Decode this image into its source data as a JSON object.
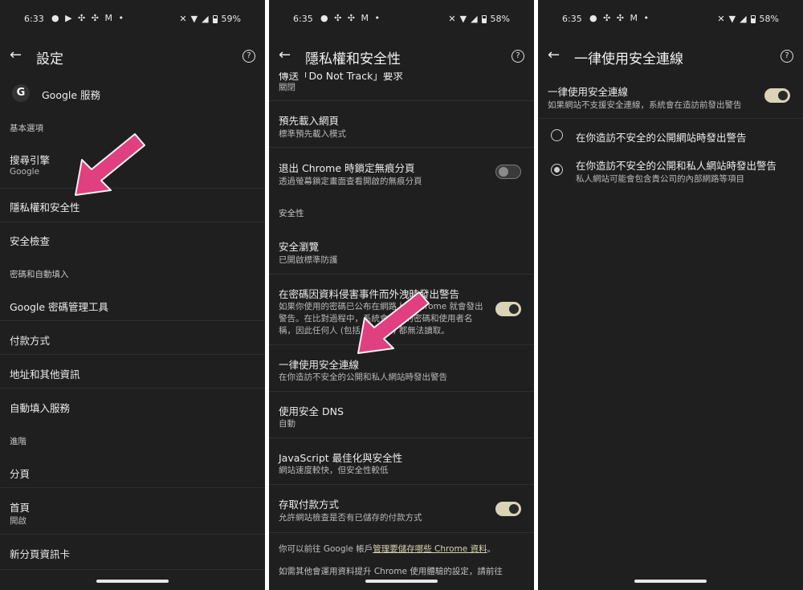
{
  "status_bars": {
    "p1": {
      "time": "6:33",
      "notif": "● ▶ ✣ ✣ M •",
      "battery": "59%"
    },
    "p2": {
      "time": "6:35",
      "notif": "● ✣ ✣ M •",
      "battery": "58%"
    },
    "p3": {
      "time": "6:35",
      "notif": "● ✣ ✣ M •",
      "battery": "58%"
    }
  },
  "panel1": {
    "title": "設定",
    "google_label": "Google 服務",
    "sections": {
      "basic": "基本選項",
      "passwords": "密碼和自動填入",
      "advanced": "進階"
    },
    "items": {
      "search_title": "搜尋引擎",
      "search_sub": "Google",
      "privacy": "隱私權和安全性",
      "safety_check": "安全檢查",
      "password_manager": "Google 密碼管理工具",
      "payment": "付款方式",
      "address": "地址和其他資訊",
      "autofill": "自動填入服務",
      "tabs": "分頁",
      "home_title": "首頁",
      "home_sub": "開啟",
      "new_tab_cards": "新分頁資訊卡"
    }
  },
  "panel2": {
    "title": "隱私權和安全性",
    "dnt_title": "傳送「Do Not Track」要求",
    "dnt_sub": "關閉",
    "preload_title": "預先載入網頁",
    "preload_sub": "標準預先載入模式",
    "lock_incognito_title": "退出 Chrome 時鎖定無痕分頁",
    "lock_incognito_sub": "透過螢幕鎖定畫面查看開啟的無痕分頁",
    "security_section": "安全性",
    "safe_browsing_title": "安全瀏覽",
    "safe_browsing_sub": "已開啟標準防護",
    "breach_title": "在密碼因資料侵害事件而外洩時發出警告",
    "breach_sub_1": "如果你使用的密碼已公布在網路上，Chrome 就會發出",
    "breach_sub_2": "警告。在比對過程中，系統會加密的密碼和使用者名",
    "breach_sub_3": "稱，因此任何人 (包括 Google) 都無法讀取。",
    "https_title": "一律使用安全連線",
    "https_sub": "在你造訪不安全的公開和私人網站時發出警告",
    "dns_title": "使用安全 DNS",
    "dns_sub": "自動",
    "js_title": "JavaScript 最佳化與安全性",
    "js_sub": "網站速度較快，但安全性較低",
    "payment_title": "存取付款方式",
    "payment_sub": "允許網站檢查是否有已儲存的付款方式",
    "footer_prefix": "你可以前往 Google 帳戶",
    "footer_link": "管理要儲存哪些 Chrome 資料",
    "footer_suffix": "。",
    "footer_2": "如需其他會運用資料提升 Chrome 使用體驗的設定，請前往"
  },
  "panel3": {
    "title": "一律使用安全連線",
    "main_title": "一律使用安全連線",
    "main_sub": "如果網站不支援安全連線，系統會在造訪前發出警告",
    "option1": "在你造訪不安全的公開網站時發出警告",
    "option2_title": "在你造訪不安全的公開和私人網站時發出警告",
    "option2_sub": "私人網站可能會包含貴公司的內部網路等項目"
  },
  "colors": {
    "background": "#1f1f1f",
    "toggle_on": "#d9d4b8",
    "arrow": "#e0407f"
  }
}
